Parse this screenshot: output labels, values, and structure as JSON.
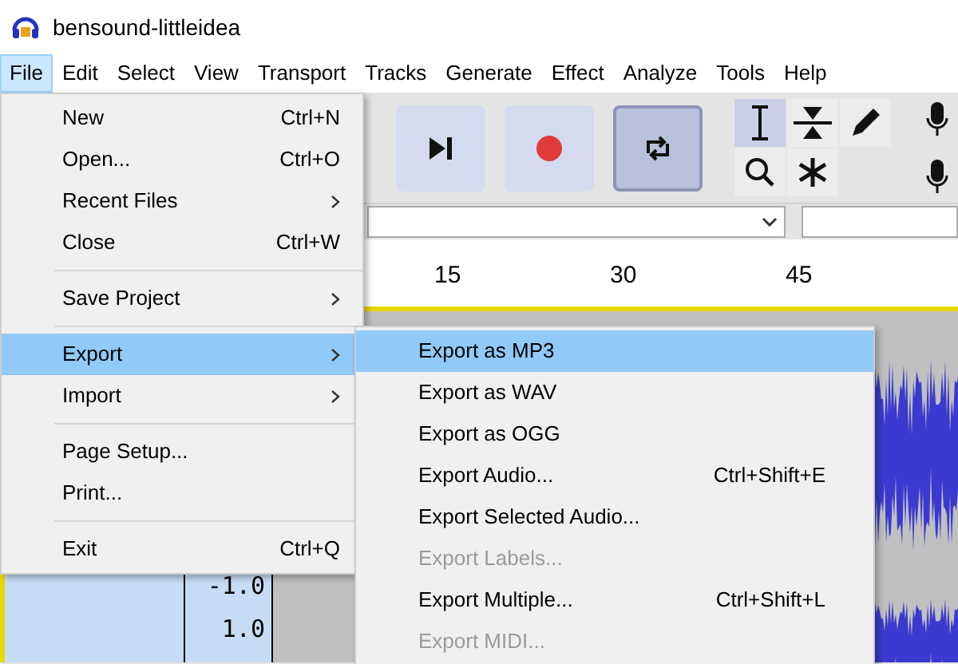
{
  "window": {
    "title": "bensound-littleidea"
  },
  "menu_bar": [
    {
      "label": "File",
      "selected": true
    },
    {
      "label": "Edit",
      "selected": false
    },
    {
      "label": "Select",
      "selected": false
    },
    {
      "label": "View",
      "selected": false
    },
    {
      "label": "Transport",
      "selected": false
    },
    {
      "label": "Tracks",
      "selected": false
    },
    {
      "label": "Generate",
      "selected": false
    },
    {
      "label": "Effect",
      "selected": false
    },
    {
      "label": "Analyze",
      "selected": false
    },
    {
      "label": "Tools",
      "selected": false
    },
    {
      "label": "Help",
      "selected": false
    }
  ],
  "file_menu": [
    {
      "kind": "item",
      "label": "New",
      "shortcut": "Ctrl+N",
      "submenu": false,
      "selected": false
    },
    {
      "kind": "item",
      "label": "Open...",
      "shortcut": "Ctrl+O",
      "submenu": false,
      "selected": false
    },
    {
      "kind": "item",
      "label": "Recent Files",
      "submenu": true,
      "selected": false
    },
    {
      "kind": "item",
      "label": "Close",
      "shortcut": "Ctrl+W",
      "submenu": false,
      "selected": false
    },
    {
      "kind": "separator"
    },
    {
      "kind": "item",
      "label": "Save Project",
      "submenu": true,
      "selected": false
    },
    {
      "kind": "separator"
    },
    {
      "kind": "item",
      "label": "Export",
      "submenu": true,
      "selected": true
    },
    {
      "kind": "item",
      "label": "Import",
      "submenu": true,
      "selected": false
    },
    {
      "kind": "separator"
    },
    {
      "kind": "item",
      "label": "Page Setup...",
      "submenu": false,
      "selected": false
    },
    {
      "kind": "item",
      "label": "Print...",
      "submenu": false,
      "selected": false
    },
    {
      "kind": "separator"
    },
    {
      "kind": "item",
      "label": "Exit",
      "shortcut": "Ctrl+Q",
      "submenu": false,
      "selected": false
    }
  ],
  "export_submenu": [
    {
      "label": "Export as MP3",
      "selected": true,
      "disabled": false
    },
    {
      "label": "Export as WAV",
      "selected": false,
      "disabled": false
    },
    {
      "label": "Export as OGG",
      "selected": false,
      "disabled": false
    },
    {
      "label": "Export Audio...",
      "shortcut": "Ctrl+Shift+E",
      "selected": false,
      "disabled": false
    },
    {
      "label": "Export Selected Audio...",
      "selected": false,
      "disabled": false
    },
    {
      "label": "Export Labels...",
      "selected": false,
      "disabled": true
    },
    {
      "label": "Export Multiple...",
      "shortcut": "Ctrl+Shift+L",
      "selected": false,
      "disabled": false
    },
    {
      "label": "Export MIDI...",
      "selected": false,
      "disabled": true
    }
  ],
  "ruler": {
    "labels": [
      "15",
      "30",
      "45"
    ]
  },
  "track": {
    "scale_labels": [
      "-1.0",
      "1.0"
    ]
  }
}
